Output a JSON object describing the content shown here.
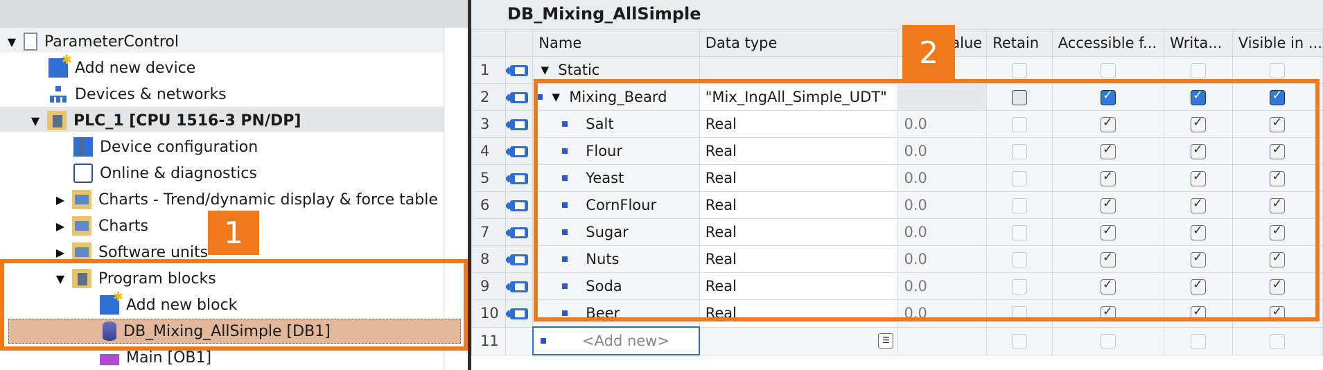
{
  "tree": {
    "items": [
      {
        "label": "ParameterControl",
        "icon": "project-icon"
      },
      {
        "label": "Add new device",
        "icon": "add-device-icon"
      },
      {
        "label": "Devices & networks",
        "icon": "network-icon"
      },
      {
        "label": "PLC_1 [CPU 1516-3 PN/DP]",
        "icon": "plc-icon"
      },
      {
        "label": "Device configuration",
        "icon": "device-config-icon"
      },
      {
        "label": "Online & diagnostics",
        "icon": "diagnostics-icon"
      },
      {
        "label": "Charts - Trend/dynamic display & force table",
        "icon": "trend-chart-icon"
      },
      {
        "label": "Charts",
        "icon": "charts-folder-icon"
      },
      {
        "label": "Software units",
        "icon": "software-units-icon"
      },
      {
        "label": "Program blocks",
        "icon": "program-blocks-icon"
      },
      {
        "label": "Add new block",
        "icon": "add-block-icon"
      },
      {
        "label": "DB_Mixing_AllSimple [DB1]",
        "icon": "data-block-icon"
      },
      {
        "label": "Main [OB1]",
        "icon": "organization-block-icon"
      }
    ]
  },
  "badges": {
    "one": "1",
    "two": "2"
  },
  "editor": {
    "title": "DB_Mixing_AllSimple",
    "columns": {
      "name": "Name",
      "datatype": "Data type",
      "startvalue": "alue",
      "retain": "Retain",
      "accessible": "Accessible f...",
      "writable": "Writa...",
      "visible": "Visible in ..."
    },
    "rows": [
      {
        "num": "1",
        "name": "Static",
        "datatype": "",
        "startvalue": ""
      },
      {
        "num": "2",
        "name": "Mixing_Beard",
        "datatype": "\"Mix_IngAll_Simple_UDT\"",
        "startvalue": ""
      },
      {
        "num": "3",
        "name": "Salt",
        "datatype": "Real",
        "startvalue": "0.0"
      },
      {
        "num": "4",
        "name": "Flour",
        "datatype": "Real",
        "startvalue": "0.0"
      },
      {
        "num": "5",
        "name": "Yeast",
        "datatype": "Real",
        "startvalue": "0.0"
      },
      {
        "num": "6",
        "name": "CornFlour",
        "datatype": "Real",
        "startvalue": "0.0"
      },
      {
        "num": "7",
        "name": "Sugar",
        "datatype": "Real",
        "startvalue": "0.0"
      },
      {
        "num": "8",
        "name": "Nuts",
        "datatype": "Real",
        "startvalue": "0.0"
      },
      {
        "num": "9",
        "name": "Soda",
        "datatype": "Real",
        "startvalue": "0.0"
      },
      {
        "num": "10",
        "name": "Beer",
        "datatype": "Real",
        "startvalue": "0.0"
      }
    ],
    "addnew": {
      "num": "11",
      "label": "<Add new>"
    }
  },
  "colors": {
    "highlight": "#ee7a1c",
    "checkbox_blue": "#2f7ad8",
    "selection": "#e1b89c"
  }
}
